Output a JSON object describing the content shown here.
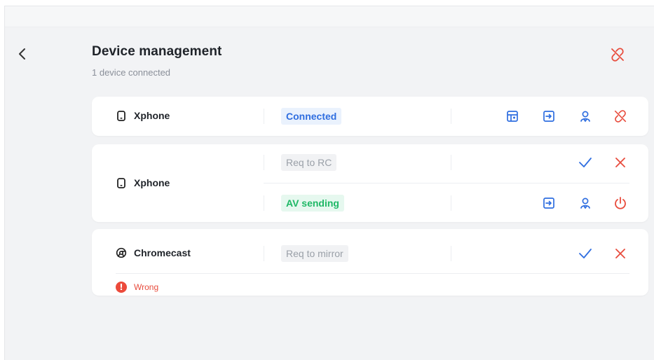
{
  "header": {
    "title": "Device management",
    "subtitle": "1 device connected"
  },
  "devices": [
    {
      "name": "Xphone",
      "icon": "phone-icon",
      "status": "Connected"
    },
    {
      "name": "Xphone",
      "icon": "phone-icon",
      "status_request": "Req to RC",
      "status_stream": "AV sending"
    },
    {
      "name": "Chromecast",
      "icon": "chromecast-icon",
      "status": "Req to mirror",
      "error": "Wrong",
      "error_glyph": "!"
    }
  ],
  "colors": {
    "accent_blue": "#2f6ee0",
    "danger_red": "#e84c3d",
    "success_green": "#1fb866",
    "muted_grey": "#9aa0a8",
    "background": "#f2f3f5"
  }
}
